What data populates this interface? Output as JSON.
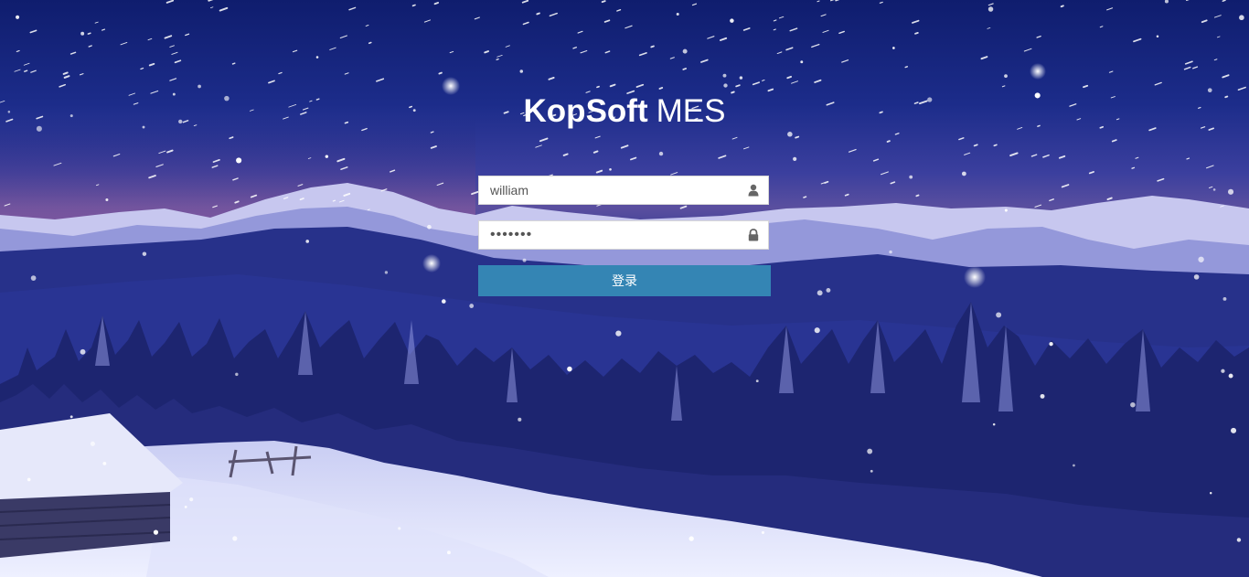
{
  "app": {
    "title_brand": "KopSoft",
    "title_suffix": "MES"
  },
  "login_form": {
    "username_value": "william",
    "password_value": "william",
    "submit_label": "登录",
    "username_icon": "user-icon",
    "password_icon": "lock-icon"
  },
  "colors": {
    "button_bg": "#3485b4",
    "text_white": "#ffffff",
    "sky_top": "#0f1d6e"
  }
}
